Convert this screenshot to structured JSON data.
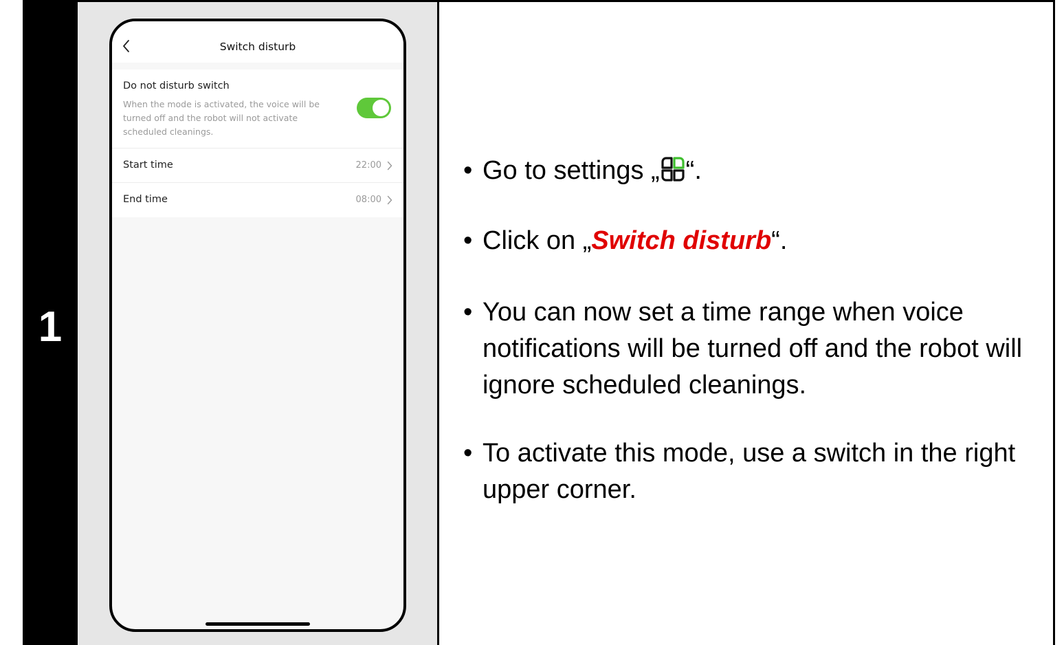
{
  "step": {
    "number": "1"
  },
  "phone": {
    "title": "Switch disturb",
    "dnd": {
      "title": "Do not disturb switch",
      "description": "When the mode is activated, the voice will be turned off and the robot will not activate scheduled cleanings.",
      "enabled": true
    },
    "rows": [
      {
        "label": "Start time",
        "value": "22:00"
      },
      {
        "label": "End time",
        "value": "08:00"
      }
    ],
    "colors": {
      "toggle_on": "#5fc83a",
      "icon_green": "#3fbf2f"
    }
  },
  "instructions": {
    "bullet_glyph": "•",
    "b1": {
      "before": "Go to settings „",
      "icon": "settings-grid-icon",
      "after": "“."
    },
    "b2": {
      "before": "Click on „",
      "emphasis": "Switch disturb",
      "after": "“.",
      "emphasis_color": "#e00000"
    },
    "b3": "You can now set a time range when voice notifications will be turned off and the robot will ignore scheduled cleanings.",
    "b4": "To activate this mode, use a switch in the right upper corner."
  }
}
